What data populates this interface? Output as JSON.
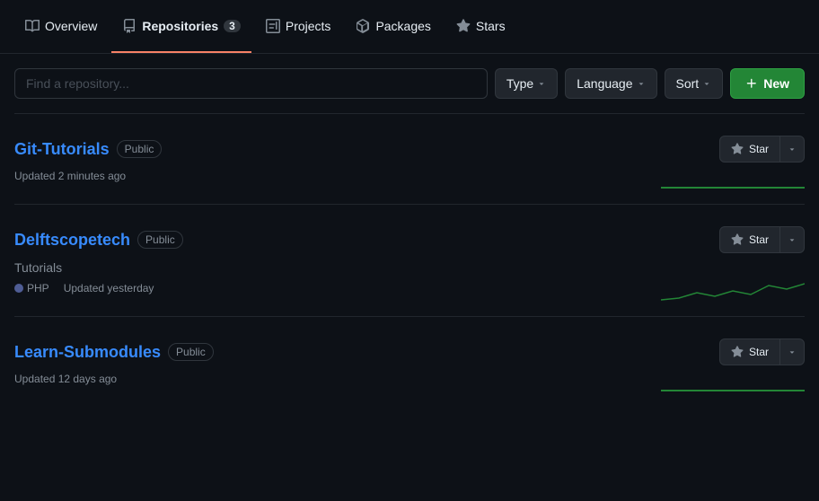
{
  "nav": {
    "items": [
      {
        "id": "overview",
        "label": "Overview",
        "icon": "book",
        "badge": null,
        "active": false
      },
      {
        "id": "repositories",
        "label": "Repositories",
        "icon": "repo",
        "badge": "3",
        "active": true
      },
      {
        "id": "projects",
        "label": "Projects",
        "icon": "project",
        "badge": null,
        "active": false
      },
      {
        "id": "packages",
        "label": "Packages",
        "icon": "package",
        "badge": null,
        "active": false
      },
      {
        "id": "stars",
        "label": "Stars",
        "icon": "star",
        "badge": null,
        "active": false
      }
    ]
  },
  "toolbar": {
    "search_placeholder": "Find a repository...",
    "type_label": "Type",
    "language_label": "Language",
    "sort_label": "Sort",
    "new_label": "New"
  },
  "repositories": [
    {
      "name": "Git-Tutorials",
      "visibility": "Public",
      "updated": "Updated 2 minutes ago",
      "description": null,
      "language": null,
      "star_label": "Star"
    },
    {
      "name": "Delftscopetech",
      "visibility": "Public",
      "updated": "Updated yesterday",
      "description": "Tutorials",
      "language": "PHP",
      "star_label": "Star"
    },
    {
      "name": "Learn-Submodules",
      "visibility": "Public",
      "updated": "Updated 12 days ago",
      "description": null,
      "language": null,
      "star_label": "Star"
    }
  ]
}
